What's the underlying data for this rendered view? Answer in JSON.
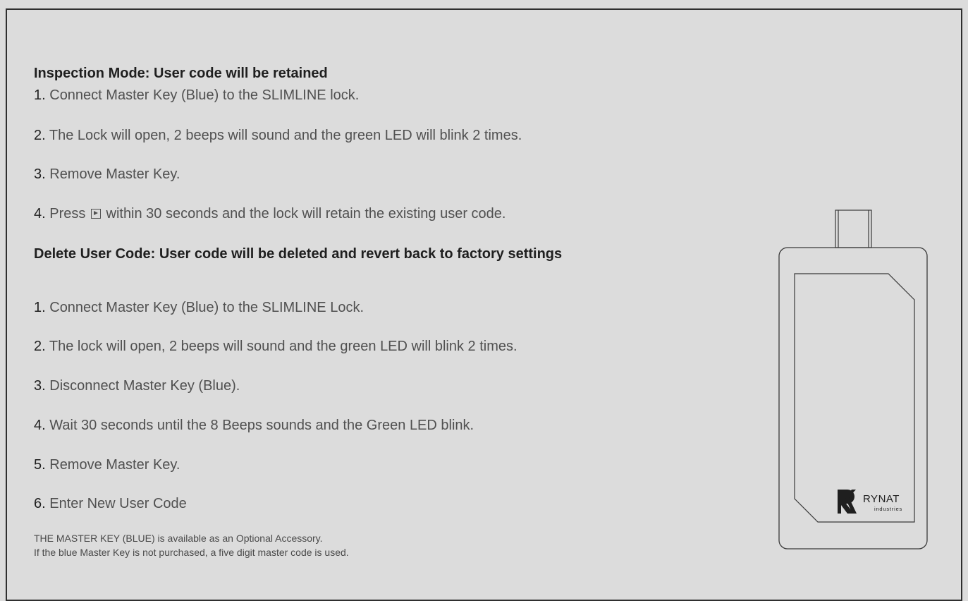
{
  "inspection": {
    "title": "Inspection Mode: User code will be retained",
    "steps": [
      {
        "num": "1.",
        "text": " Connect Master Key (Blue) to the SLIMLINE lock."
      },
      {
        "num": "2.",
        "text": " The Lock will open, 2 beeps will sound and the green LED will blink 2 times."
      },
      {
        "num": "3.",
        "text": " Remove Master Key."
      },
      {
        "num": "4.",
        "text_before": " Press ",
        "text_after": " within 30 seconds and the lock will retain the existing user code."
      }
    ]
  },
  "delete": {
    "title": "Delete User Code: User code will be deleted and revert back to factory settings",
    "steps": [
      {
        "num": "1.",
        "text": " Connect Master Key (Blue) to the SLIMLINE Lock."
      },
      {
        "num": "2.",
        "text": " The lock will open, 2 beeps will sound and the green LED will blink 2 times."
      },
      {
        "num": "3.",
        "text": " Disconnect Master Key (Blue)."
      },
      {
        "num": "4.",
        "text": " Wait 30 seconds until the 8 Beeps sounds and the Green LED blink."
      },
      {
        "num": "5.",
        "text": " Remove Master Key."
      },
      {
        "num": "6.",
        "text": " Enter New User Code"
      }
    ]
  },
  "notes": [
    "THE MASTER KEY (BLUE) is available as an Optional Accessory.",
    "If the blue Master Key is not purchased, a five digit master code is used."
  ],
  "device": {
    "brand": "RYNAT",
    "brand_sub": "industries",
    "icon": "master-key-device-illustration"
  },
  "colors": {
    "background": "#dcdcdc",
    "border": "#2f2f2f",
    "heading": "#1f1f1f",
    "body_text": "#505050"
  }
}
